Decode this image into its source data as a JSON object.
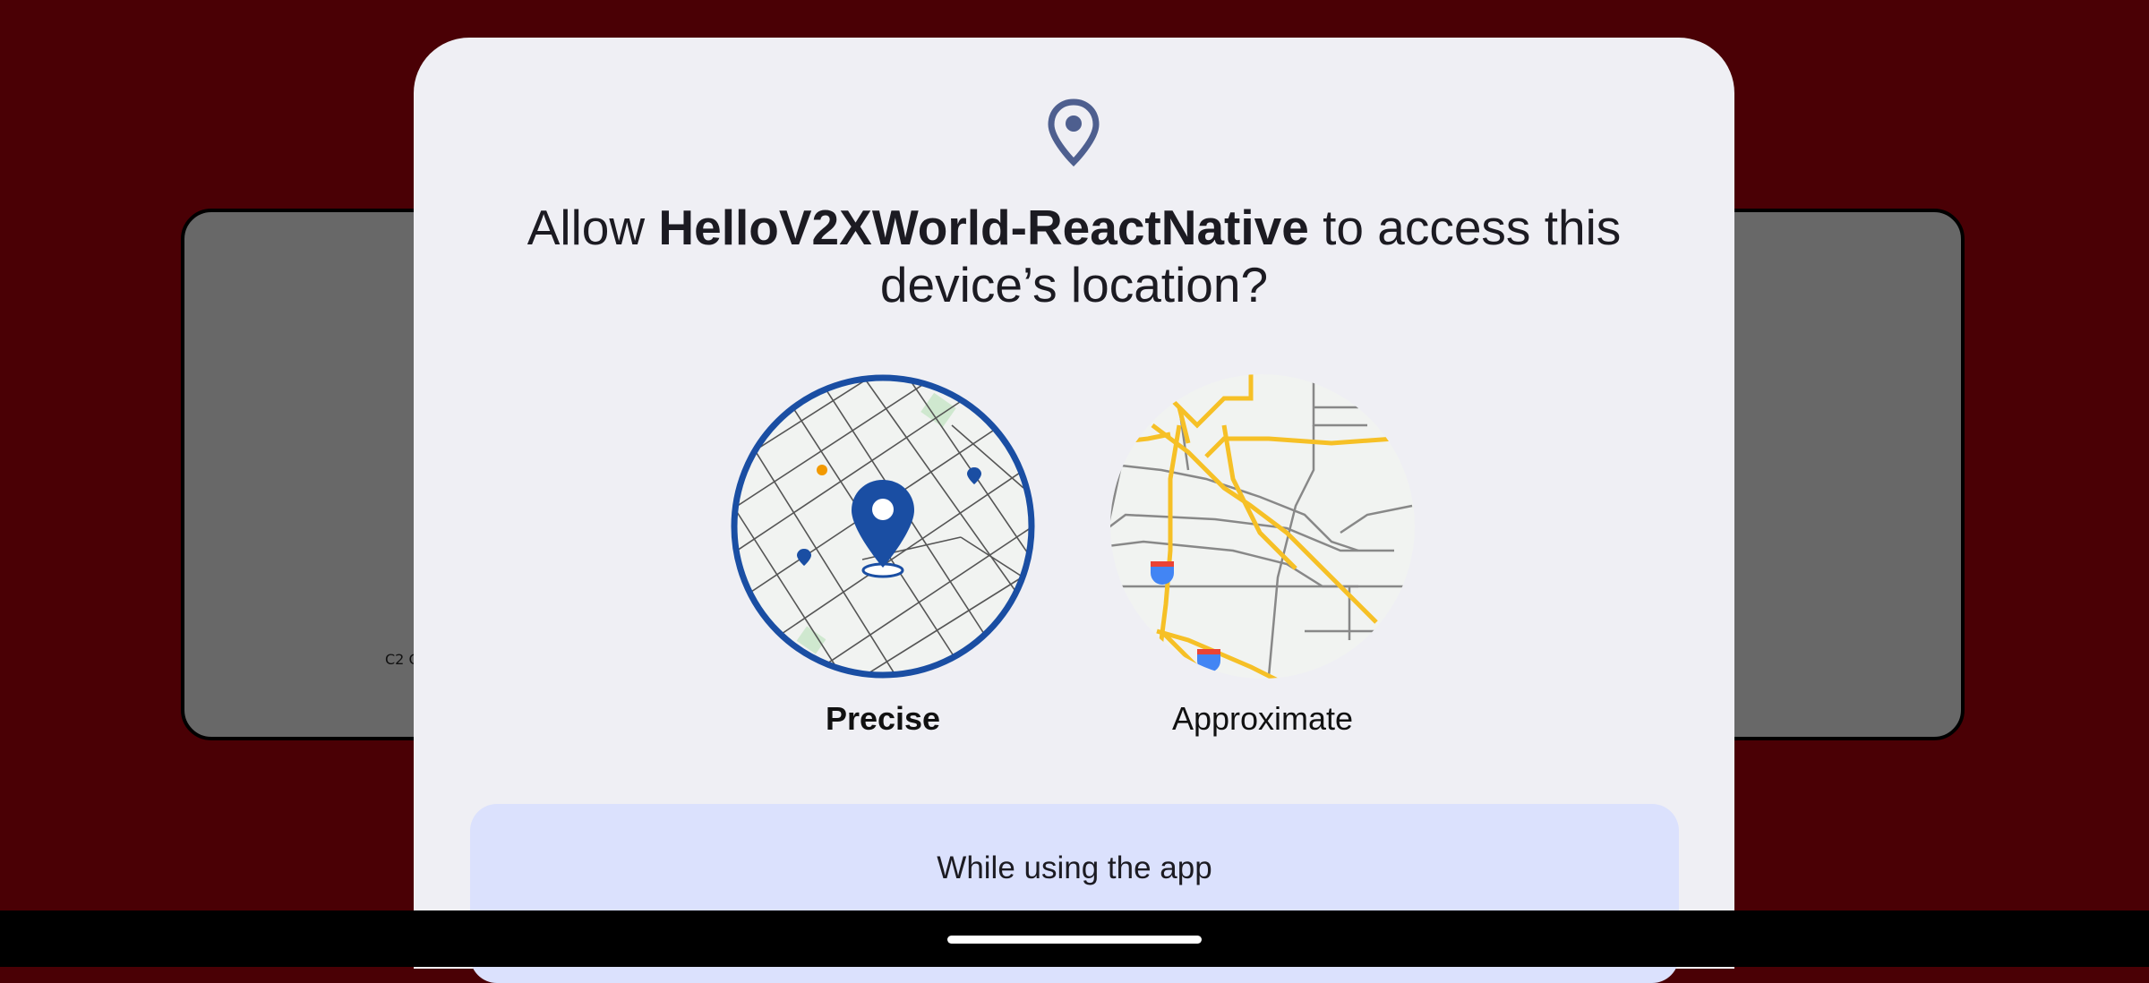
{
  "background": {
    "partial_label": "C2 G"
  },
  "dialog": {
    "icon": "location-pin-icon",
    "title_prefix": "Allow ",
    "app_name": "HelloV2XWorld-ReactNative",
    "title_suffix": " to access this device’s location?",
    "options": [
      {
        "label": "Precise",
        "selected": true,
        "icon": "precise-map-icon"
      },
      {
        "label": "Approximate",
        "selected": false,
        "icon": "approximate-map-icon"
      }
    ],
    "buttons": {
      "while_using": "While using the app"
    }
  },
  "colors": {
    "scrim": "#4a0005",
    "dialog_bg": "#efeff4",
    "accent": "#1a4ea3",
    "primary_button_bg": "#dbe1fd"
  }
}
